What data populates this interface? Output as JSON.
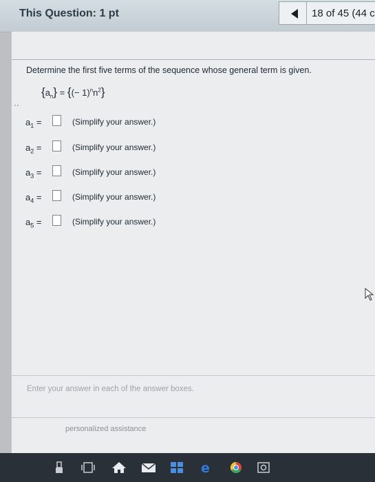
{
  "header": {
    "title": "This Question: 1 pt",
    "progress": "18 of 45 (44 c"
  },
  "question": {
    "prompt": "Determine the first five terms of the sequence whose general term is given.",
    "formula": {
      "lhs_var": "a",
      "lhs_sub": "n",
      "rhs_base": "(− 1)",
      "rhs_exp1": "n",
      "rhs_mid": "n",
      "rhs_exp2": "2"
    },
    "answers": [
      {
        "var": "a",
        "sub": "1",
        "eq": "=",
        "value": "",
        "hint": "(Simplify your answer.)"
      },
      {
        "var": "a",
        "sub": "2",
        "eq": "=",
        "value": "",
        "hint": "(Simplify your answer.)"
      },
      {
        "var": "a",
        "sub": "3",
        "eq": "=",
        "value": "",
        "hint": "(Simplify your answer.)"
      },
      {
        "var": "a",
        "sub": "4",
        "eq": "=",
        "value": "",
        "hint": "(Simplify your answer.)"
      },
      {
        "var": "a",
        "sub": "5",
        "eq": "=",
        "value": "",
        "hint": "(Simplify your answer.)"
      }
    ]
  },
  "footer": {
    "instructions": "Enter your answer in each of the answer boxes.",
    "assistance": "personalized assistance"
  },
  "taskbar": {
    "icons": [
      "usb-icon",
      "task-view-icon",
      "home-icon",
      "mail-icon",
      "windows-store-icon",
      "edge-icon",
      "chrome-icon",
      "camera-icon"
    ]
  },
  "colors": {
    "header_bg": "#c8d1d7",
    "content_bg": "#ebedef",
    "taskbar_bg": "#2a3038",
    "edge_blue": "#2f7bd9"
  }
}
